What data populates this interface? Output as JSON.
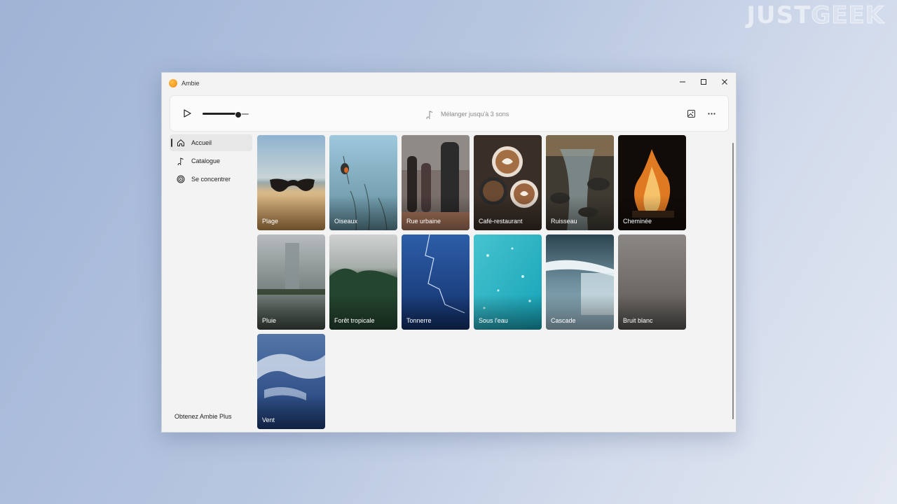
{
  "watermark": {
    "part1": "JUST",
    "part2": "GEEK"
  },
  "window": {
    "title": "Ambie"
  },
  "player": {
    "mix_hint": "Mélanger jusqu'à 3 sons",
    "volume_percent": 75
  },
  "sidebar": {
    "items": [
      {
        "label": "Accueil",
        "icon": "home-icon",
        "active": true
      },
      {
        "label": "Catalogue",
        "icon": "music-note-icon",
        "active": false
      },
      {
        "label": "Se concentrer",
        "icon": "target-icon",
        "active": false
      }
    ],
    "promo": "Obtenez Ambie Plus"
  },
  "sounds": [
    {
      "label": "Plage"
    },
    {
      "label": "Oiseaux"
    },
    {
      "label": "Rue urbaine"
    },
    {
      "label": "Café-restaurant"
    },
    {
      "label": "Ruisseau"
    },
    {
      "label": "Cheminée"
    },
    {
      "label": "Pluie"
    },
    {
      "label": "Forêt tropicale"
    },
    {
      "label": "Tonnerre"
    },
    {
      "label": "Sous l'eau"
    },
    {
      "label": "Cascade"
    },
    {
      "label": "Bruit blanc"
    },
    {
      "label": "Vent"
    }
  ],
  "colors": {
    "accent_orange": "#f39a1c",
    "window_bg": "#f3f3f3"
  }
}
